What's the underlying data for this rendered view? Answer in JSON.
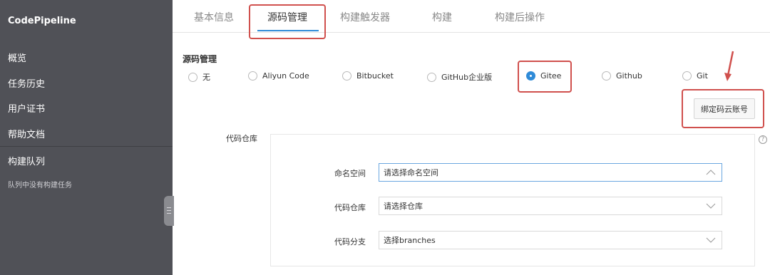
{
  "sidebar": {
    "app_title": "CodePipeline",
    "items": [
      {
        "label": "概览"
      },
      {
        "label": "任务历史"
      },
      {
        "label": "用户证书"
      },
      {
        "label": "帮助文档"
      }
    ],
    "queue_title": "构建队列",
    "queue_empty": "队列中没有构建任务",
    "background": "#505157"
  },
  "tabs": [
    {
      "label": "基本信息"
    },
    {
      "label": "源码管理",
      "active": true
    },
    {
      "label": "构建触发器"
    },
    {
      "label": "构建"
    },
    {
      "label": "构建后操作"
    }
  ],
  "source": {
    "section_label": "源码管理",
    "options": [
      {
        "label": "无"
      },
      {
        "label": "Aliyun Code"
      },
      {
        "label": "Bitbucket"
      },
      {
        "label": "GitHub企业版"
      },
      {
        "label": "Gitee",
        "checked": true
      },
      {
        "label": "Github"
      },
      {
        "label": "Git"
      }
    ],
    "bind_button": "绑定码云账号"
  },
  "repo": {
    "label": "代码仓库",
    "fields": [
      {
        "label": "命名空间",
        "value": "请选择命名空间",
        "expanded": true
      },
      {
        "label": "代码仓库",
        "value": "请选择仓库",
        "expanded": false
      },
      {
        "label": "代码分支",
        "value": "选择branches",
        "expanded": false
      }
    ]
  },
  "colors": {
    "accent": "#2f8bd8",
    "highlight": "#d0504d"
  }
}
